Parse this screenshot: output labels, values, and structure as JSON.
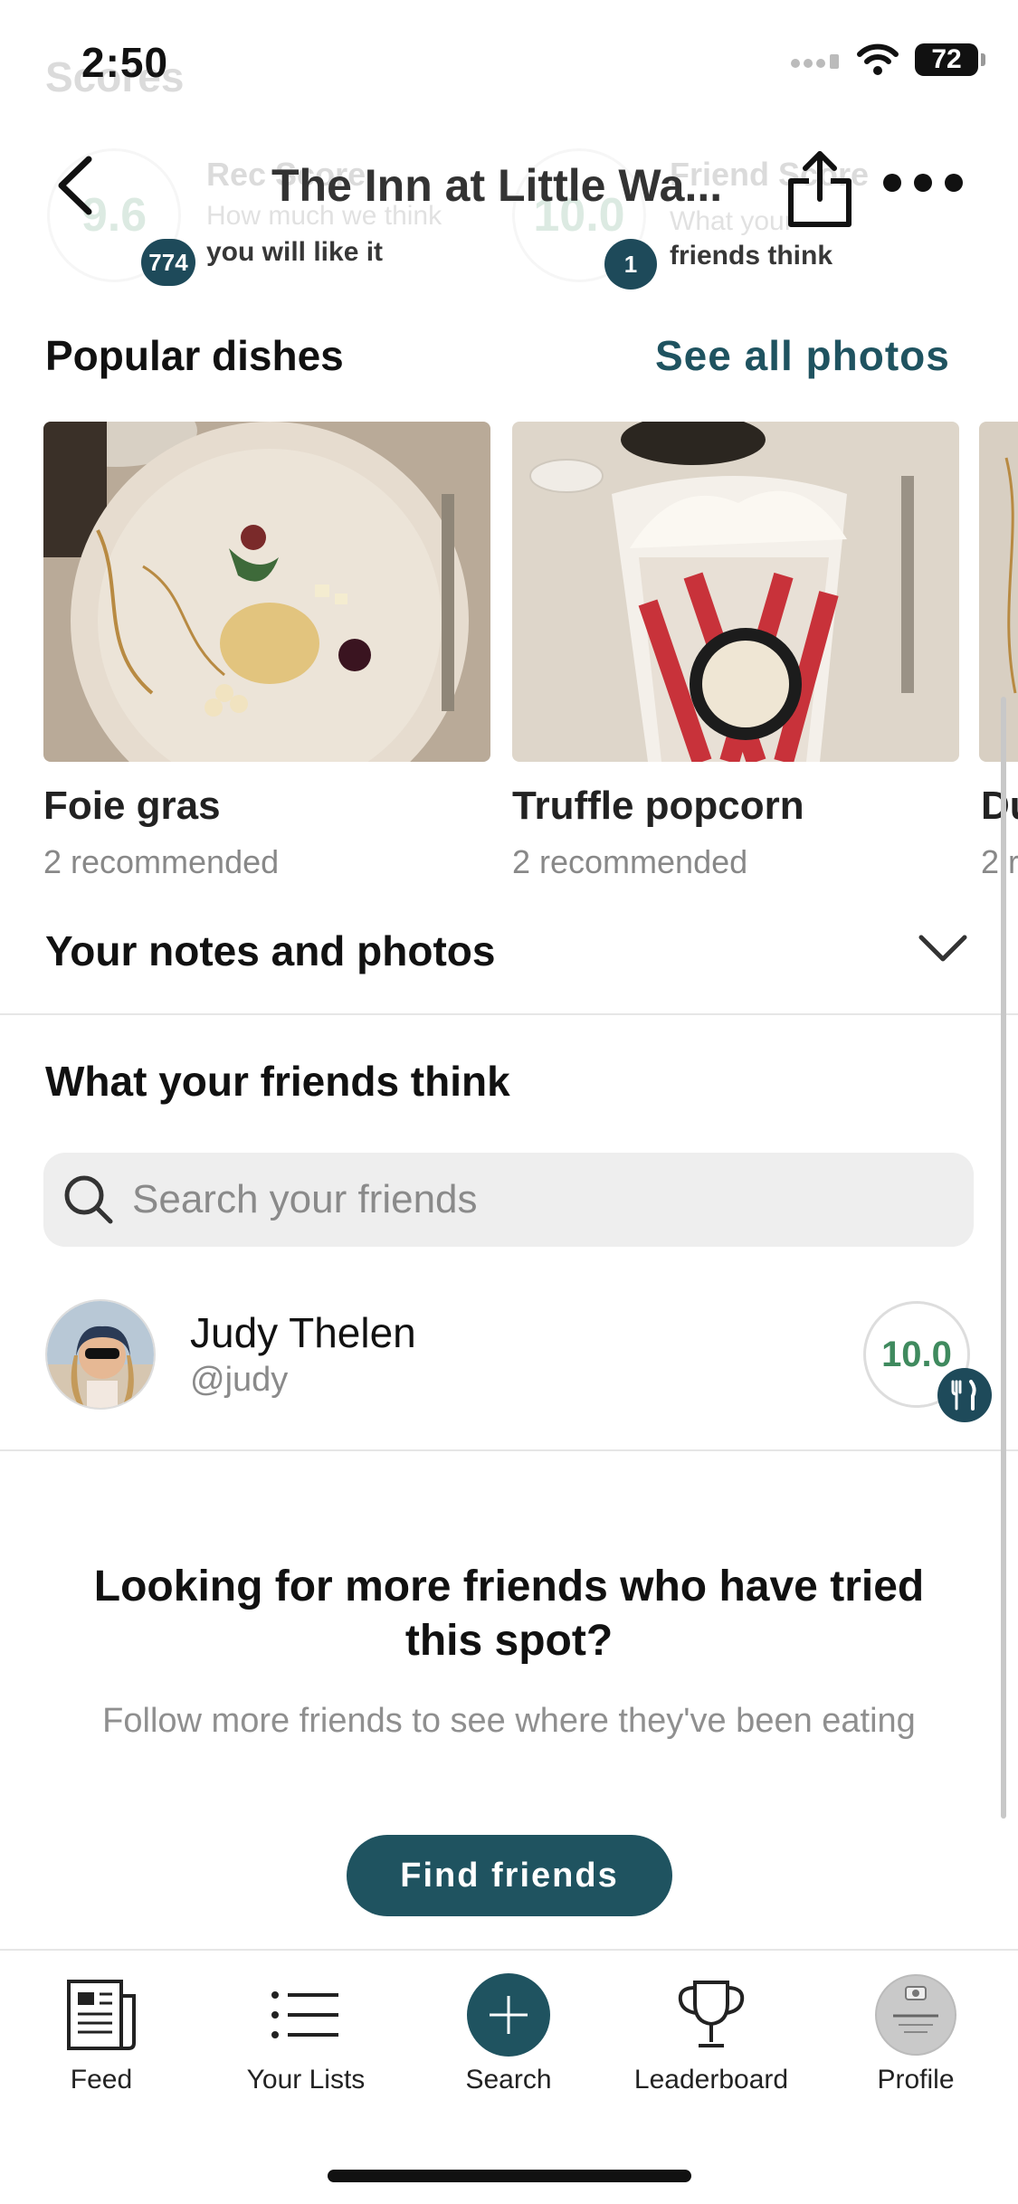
{
  "status_bar": {
    "time": "2:50",
    "battery": "72"
  },
  "scrolled_under": {
    "section_title": "Scores",
    "rec_score": {
      "value": "9.6",
      "count": "774",
      "label": "Rec Score",
      "sub1": "How much we think",
      "sub2": "you will like it"
    },
    "friend_score": {
      "value": "10.0",
      "count": "1",
      "label": "Friend Score",
      "sub1": "What your",
      "sub2": "friends think"
    }
  },
  "header": {
    "title": "The Inn at Little Wa..."
  },
  "popular_dishes": {
    "heading": "Popular dishes",
    "see_all": "See all photos",
    "items": [
      {
        "name": "Foie gras",
        "recommended": "2 recommended"
      },
      {
        "name": "Truffle popcorn",
        "recommended": "2 recommended"
      },
      {
        "name": "Du",
        "recommended": "2 r"
      }
    ]
  },
  "notes": {
    "heading": "Your notes and photos"
  },
  "friends": {
    "heading": "What your friends think",
    "search_placeholder": "Search your friends",
    "list": [
      {
        "name": "Judy Thelen",
        "handle": "@judy",
        "score": "10.0"
      }
    ]
  },
  "promo": {
    "title": "Looking for more friends who have tried this spot?",
    "subtitle": "Follow more friends to see where they've been eating",
    "button": "Find friends"
  },
  "tabs": [
    {
      "label": "Feed",
      "icon": "newspaper-icon"
    },
    {
      "label": "Your Lists",
      "icon": "list-icon"
    },
    {
      "label": "Search",
      "icon": "plus-icon"
    },
    {
      "label": "Leaderboard",
      "icon": "trophy-icon"
    },
    {
      "label": "Profile",
      "icon": "profile-avatar"
    }
  ],
  "colors": {
    "accent": "#1f5360",
    "score_green": "#3f8a5e",
    "muted": "#8a8a8a"
  }
}
